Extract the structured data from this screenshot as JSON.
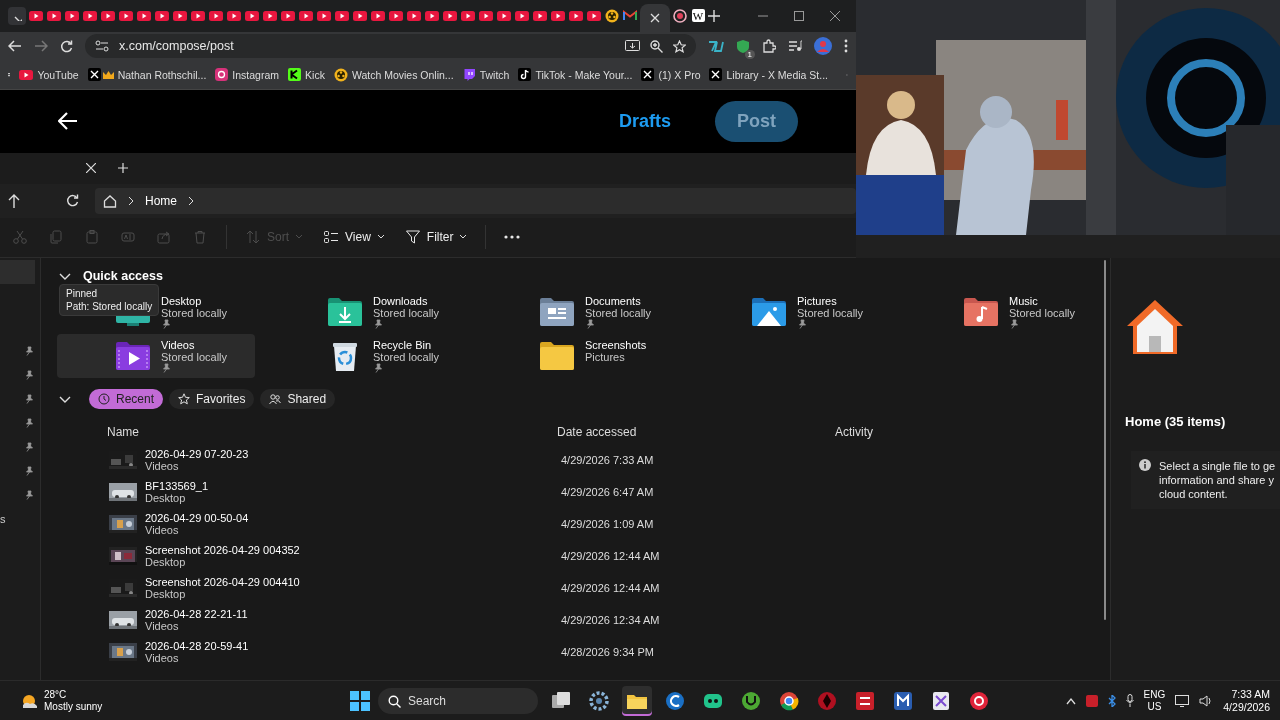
{
  "browser": {
    "tabs": [
      {
        "kind": "youtube",
        "selected": false
      },
      {
        "kind": "youtube",
        "selected": false
      },
      {
        "kind": "youtube",
        "selected": false
      },
      {
        "kind": "youtube",
        "selected": false
      },
      {
        "kind": "youtube",
        "selected": false
      },
      {
        "kind": "youtube",
        "selected": false
      },
      {
        "kind": "youtube",
        "selected": false
      },
      {
        "kind": "youtube",
        "selected": false
      },
      {
        "kind": "youtube",
        "selected": false
      },
      {
        "kind": "youtube",
        "selected": false
      },
      {
        "kind": "youtube",
        "selected": false
      },
      {
        "kind": "youtube",
        "selected": false
      },
      {
        "kind": "youtube",
        "selected": false
      },
      {
        "kind": "youtube",
        "selected": false
      },
      {
        "kind": "youtube",
        "selected": false
      },
      {
        "kind": "youtube",
        "selected": false
      },
      {
        "kind": "youtube",
        "selected": false
      },
      {
        "kind": "youtube",
        "selected": false
      },
      {
        "kind": "youtube",
        "selected": false
      },
      {
        "kind": "youtube",
        "selected": false
      },
      {
        "kind": "youtube",
        "selected": false
      },
      {
        "kind": "youtube",
        "selected": false
      },
      {
        "kind": "youtube",
        "selected": false
      },
      {
        "kind": "youtube",
        "selected": false
      },
      {
        "kind": "youtube",
        "selected": false
      },
      {
        "kind": "youtube",
        "selected": false
      },
      {
        "kind": "youtube",
        "selected": false
      },
      {
        "kind": "youtube",
        "selected": false
      },
      {
        "kind": "youtube",
        "selected": false
      },
      {
        "kind": "youtube",
        "selected": false
      },
      {
        "kind": "youtube",
        "selected": false
      },
      {
        "kind": "youtube",
        "selected": false
      },
      {
        "kind": "reel",
        "selected": false
      },
      {
        "kind": "mail",
        "selected": false
      },
      {
        "selected": true
      },
      {
        "kind": "record",
        "selected": false
      },
      {
        "kind": "wiki",
        "selected": false,
        "glyph": "W"
      }
    ],
    "url": "x.com/compose/post",
    "extension_badge": "1",
    "bookmarks": [
      {
        "kind": "youtube",
        "label": "YouTube"
      },
      {
        "kind": "x-crown",
        "label": "Nathan Rothschil..."
      },
      {
        "kind": "instagram",
        "label": "Instagram"
      },
      {
        "kind": "kick",
        "label": "Kick"
      },
      {
        "kind": "reel",
        "label": "Watch Movies Onlin..."
      },
      {
        "kind": "twitch",
        "label": "Twitch"
      },
      {
        "kind": "tiktok",
        "label": "TikTok - Make Your..."
      },
      {
        "kind": "x",
        "label": "(1) X Pro"
      },
      {
        "kind": "x",
        "label": "Library - X Media St..."
      }
    ]
  },
  "compose": {
    "drafts": "Drafts",
    "post": {
      "label": "Post",
      "disabled": true
    }
  },
  "explorer": {
    "address": "Home",
    "toolbar": [
      {
        "kind": "cut",
        "disabled": true
      },
      {
        "kind": "copy",
        "disabled": true
      },
      {
        "kind": "paste",
        "disabled": true
      },
      {
        "kind": "rename",
        "disabled": true
      },
      {
        "kind": "share",
        "disabled": true
      },
      {
        "kind": "delete",
        "disabled": true
      },
      {
        "kind": "sort",
        "label": "Sort",
        "disabled": true
      },
      {
        "kind": "view",
        "label": "View",
        "disabled": false
      },
      {
        "kind": "filter",
        "label": "Filter",
        "disabled": false
      },
      {
        "kind": "more",
        "disabled": false
      }
    ],
    "sidebar": {
      "items": [
        {
          "pinned": true
        },
        {
          "pinned": true
        },
        {
          "pinned": true
        },
        {
          "pinned": true
        },
        {
          "pinned": true
        },
        {
          "pinned": true
        },
        {
          "pinned": true
        }
      ],
      "fragment": "s"
    },
    "quick_access": {
      "title": "Quick access",
      "expanded": true,
      "items": [
        {
          "kind": "desktop",
          "name": "Desktop",
          "location": "Stored locally",
          "pinned": true,
          "hovered": false
        },
        {
          "kind": "downloads",
          "name": "Downloads",
          "location": "Stored locally",
          "pinned": true,
          "hovered": false
        },
        {
          "kind": "documents",
          "name": "Documents",
          "location": "Stored locally",
          "pinned": true,
          "hovered": false
        },
        {
          "kind": "pictures",
          "name": "Pictures",
          "location": "Stored locally",
          "pinned": true,
          "hovered": false
        },
        {
          "kind": "music",
          "name": "Music",
          "location": "Stored locally",
          "pinned": true,
          "hovered": false
        },
        {
          "kind": "videos",
          "name": "Videos",
          "location": "Stored locally",
          "pinned": true,
          "hovered": true
        },
        {
          "kind": "recycle",
          "name": "Recycle Bin",
          "location": "Stored locally",
          "pinned": true,
          "hovered": false
        },
        {
          "kind": "screenshots",
          "name": "Screenshots",
          "location": "Pictures",
          "pinned": false,
          "hovered": false
        }
      ]
    },
    "tooltip": [
      "Pinned",
      "Path: Stored locally"
    ],
    "recent_expanded": true,
    "filters": [
      {
        "kind": "clock",
        "label": "Recent",
        "selected": true
      },
      {
        "kind": "star",
        "label": "Favorites",
        "selected": false
      },
      {
        "kind": "people",
        "label": "Shared",
        "selected": false
      }
    ],
    "columns": [
      "Name",
      "Date accessed",
      "Activity"
    ],
    "rows": [
      {
        "name": "2026-04-29 07-20-23",
        "location": "Videos",
        "date": "4/29/2026 7:33 AM"
      },
      {
        "name": "BF133569_1",
        "location": "Desktop",
        "date": "4/29/2026 6:47 AM"
      },
      {
        "name": "2026-04-29 00-50-04",
        "location": "Videos",
        "date": "4/29/2026 1:09 AM"
      },
      {
        "name": "Screenshot 2026-04-29 004352",
        "location": "Desktop",
        "date": "4/29/2026 12:44 AM"
      },
      {
        "name": "Screenshot 2026-04-29 004410",
        "location": "Desktop",
        "date": "4/29/2026 12:44 AM"
      },
      {
        "name": "2026-04-28 22-21-11",
        "location": "Videos",
        "date": "4/29/2026 12:34 AM"
      },
      {
        "name": "2026-04-28 20-59-41",
        "location": "Videos",
        "date": "4/28/2026 9:34 PM"
      }
    ],
    "details": {
      "title": "Home (35 items)",
      "info_lines": [
        "Select a single file to ge",
        "information and share y",
        "cloud content."
      ]
    }
  },
  "taskbar": {
    "temperature": "28°C",
    "weather": "Mostly sunny",
    "search_placeholder": "Search",
    "apps": [
      {
        "kind": "taskview",
        "active": false
      },
      {
        "kind": "settings",
        "active": false
      },
      {
        "kind": "explorer",
        "active": true
      },
      {
        "kind": "ccleaner",
        "active": false
      },
      {
        "kind": "discord",
        "active": false
      },
      {
        "kind": "torrent",
        "active": false
      },
      {
        "kind": "chrome",
        "active": false
      },
      {
        "kind": "redapp",
        "active": false
      },
      {
        "kind": "mixer",
        "active": false
      },
      {
        "kind": "bluebox",
        "active": false
      },
      {
        "kind": "snip",
        "active": false
      },
      {
        "kind": "redcircle",
        "active": false
      }
    ],
    "language": "ENG",
    "region": "US",
    "time": "7:33 AM",
    "date": "4/29/2026"
  }
}
